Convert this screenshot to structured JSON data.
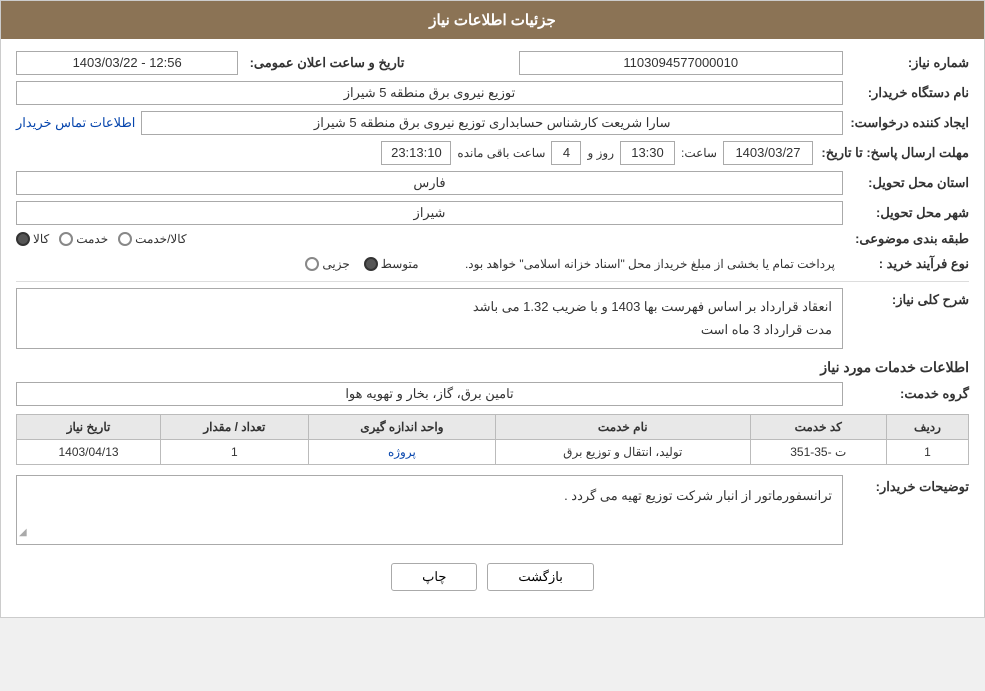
{
  "header": {
    "title": "جزئیات اطلاعات نیاز"
  },
  "fields": {
    "need_number_label": "شماره نیاز:",
    "need_number_value": "1103094577000010",
    "buyer_org_label": "نام دستگاه خریدار:",
    "buyer_org_value": "توزیع نیروی برق منطقه 5 شیراز",
    "requester_label": "ایجاد کننده درخواست:",
    "requester_value": "سارا شریعت کارشناس حسابداری  توزیع نیروی برق منطقه 5 شیراز",
    "contact_link": "اطلاعات تماس خریدار",
    "deadline_label": "مهلت ارسال پاسخ: تا تاریخ:",
    "deadline_date": "1403/03/27",
    "deadline_time_label": "ساعت:",
    "deadline_time": "13:30",
    "deadline_days_label": "روز و",
    "deadline_days": "4",
    "deadline_remaining_label": "ساعت باقی مانده",
    "deadline_remaining": "23:13:10",
    "province_label": "استان محل تحویل:",
    "province_value": "فارس",
    "city_label": "شهر محل تحویل:",
    "city_value": "شیراز",
    "category_label": "طبقه بندی موضوعی:",
    "category_options": [
      "کالا",
      "خدمت",
      "کالا/خدمت"
    ],
    "category_selected": "کالا",
    "purchase_type_label": "نوع فرآیند خرید :",
    "purchase_options": [
      "جزیی",
      "متوسط"
    ],
    "purchase_selected": "متوسط",
    "payment_text": "پرداخت تمام یا بخشی از مبلغ خریداز محل \"اسناد خزانه اسلامی\" خواهد بود.",
    "need_desc_label": "شرح کلی نیاز:",
    "need_desc_line1": "انعقاد قرارداد بر اساس فهرست بها 1403 و با ضریب 1.32 می باشد",
    "need_desc_line2": "مدت قرارداد 3 ماه است",
    "service_info_label": "اطلاعات خدمات مورد نیاز",
    "service_group_label": "گروه خدمت:",
    "service_group_value": "تامین برق، گاز، بخار و تهویه هوا",
    "table": {
      "headers": [
        "ردیف",
        "کد خدمت",
        "نام خدمت",
        "واحد اندازه گیری",
        "تعداد / مقدار",
        "تاریخ نیاز"
      ],
      "rows": [
        [
          "1",
          "ت -35-351",
          "تولید، انتقال و توزیع برق",
          "پروژه",
          "1",
          "1403/04/13"
        ]
      ]
    },
    "buyer_notes_label": "توضیحات خریدار:",
    "buyer_notes_value": "ترانسفورماتور از انبار شرکت توزیع تهیه می گردد .",
    "btn_print": "چاپ",
    "btn_back": "بازگشت",
    "announce_datetime_label": "تاریخ و ساعت اعلان عمومی:",
    "announce_datetime_value": "1403/03/22 - 12:56"
  }
}
